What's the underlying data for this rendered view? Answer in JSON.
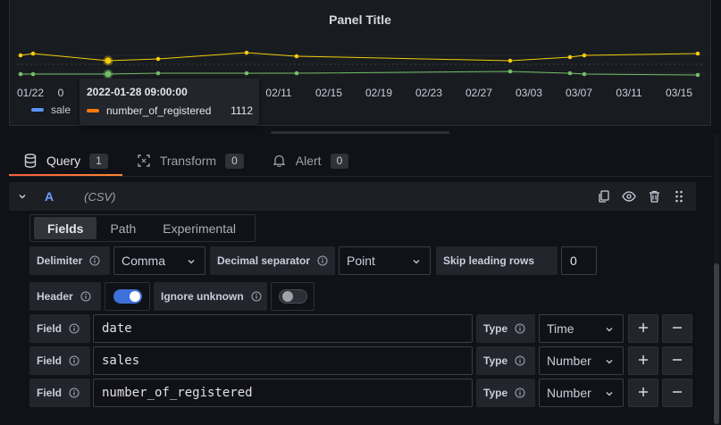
{
  "panel": {
    "title": "Panel Title",
    "x_ticks": [
      "01/22",
      "0",
      "02/11",
      "02/15",
      "02/19",
      "02/23",
      "02/27",
      "03/03",
      "03/07",
      "03/11",
      "03/15"
    ],
    "tooltip": {
      "time": "2022-01-28 09:00:00",
      "series_name": "number_of_registered",
      "value": "1112"
    },
    "legend": {
      "series_label": "sale",
      "series_color": "#5794f2"
    },
    "colors": {
      "yellow_series": "#f2cc0c",
      "green_series": "#73bf69",
      "orange_series": "#ff780a"
    }
  },
  "chart_data": {
    "type": "line",
    "title": "Panel Title",
    "x_tick_labels": [
      "01/22",
      "02/11",
      "02/15",
      "02/19",
      "02/23",
      "02/27",
      "03/03",
      "03/07",
      "03/11",
      "03/15"
    ],
    "series": [
      {
        "color": "#f2cc0c",
        "values": [
          62,
          60,
          68,
          66,
          59,
          63,
          68,
          64,
          62,
          60
        ]
      },
      {
        "color": "#73bf69",
        "values": [
          83,
          83,
          83,
          82,
          82,
          82,
          80,
          82,
          83,
          84
        ]
      }
    ],
    "grid": true
  },
  "tabs": [
    {
      "label": "Query",
      "count": "1",
      "icon": "database-icon",
      "active": true
    },
    {
      "label": "Transform",
      "count": "0",
      "icon": "transform-icon",
      "active": false
    },
    {
      "label": "Alert",
      "count": "0",
      "icon": "bell-icon",
      "active": false
    }
  ],
  "query": {
    "letter": "A",
    "datasource": "(CSV)"
  },
  "subtabs": [
    "Fields",
    "Path",
    "Experimental"
  ],
  "form": {
    "delimiter_label": "Delimiter",
    "delimiter_value": "Comma",
    "decimal_label": "Decimal separator",
    "decimal_value": "Point",
    "skip_label": "Skip leading rows",
    "skip_value": "0",
    "header_label": "Header",
    "header_on": true,
    "ignore_label": "Ignore unknown",
    "ignore_on": false,
    "field_label": "Field",
    "type_label": "Type",
    "fields": [
      {
        "name": "date",
        "type": "Time"
      },
      {
        "name": "sales",
        "type": "Number"
      },
      {
        "name": "number_of_registered",
        "type": "Number"
      }
    ]
  }
}
